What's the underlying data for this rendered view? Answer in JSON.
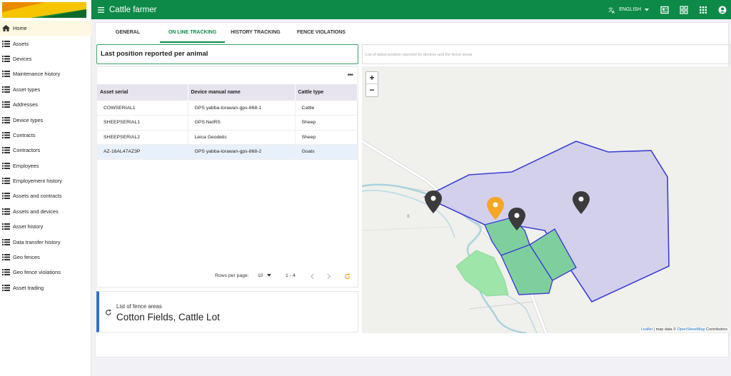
{
  "app": {
    "title": "Cattle farmer"
  },
  "topbar": {
    "language": "ENGLISH"
  },
  "sidebar": {
    "items": [
      {
        "label": "Home",
        "icon": "home-icon",
        "active": true
      },
      {
        "label": "Assets",
        "icon": "list-icon"
      },
      {
        "label": "Devices",
        "icon": "list-icon"
      },
      {
        "label": "Maintenance history",
        "icon": "list-icon"
      },
      {
        "label": "Asset types",
        "icon": "list-icon"
      },
      {
        "label": "Addresses",
        "icon": "list-icon"
      },
      {
        "label": "Device types",
        "icon": "list-icon"
      },
      {
        "label": "Contracts",
        "icon": "list-icon"
      },
      {
        "label": "Contractors",
        "icon": "list-icon"
      },
      {
        "label": "Employees",
        "icon": "list-icon"
      },
      {
        "label": "Employement history",
        "icon": "list-icon"
      },
      {
        "label": "Assets and contracts",
        "icon": "list-icon"
      },
      {
        "label": "Assets and devices",
        "icon": "list-icon"
      },
      {
        "label": "Asset history",
        "icon": "list-icon"
      },
      {
        "label": "Data transfer history",
        "icon": "list-icon"
      },
      {
        "label": "Geo fences",
        "icon": "list-icon"
      },
      {
        "label": "Geo fence violations",
        "icon": "list-icon"
      },
      {
        "label": "Asset trading",
        "icon": "list-icon"
      }
    ]
  },
  "tabs": [
    {
      "label": "GENERAL"
    },
    {
      "label": "ON LINE TRACKING",
      "active": true
    },
    {
      "label": "HISTORY TRACKING"
    },
    {
      "label": "FENCE VIOLATIONS"
    }
  ],
  "panel": {
    "title": "Last position reported per animal"
  },
  "map_header": {
    "text": "List of latest position reported by devices and the fence areas"
  },
  "table": {
    "columns": [
      "Asset serial",
      "Device manual name",
      "Cattle type"
    ],
    "rows": [
      [
        "COWSERIAL1",
        "GPS yabba-lorawan-gps-868-1",
        "Cattle"
      ],
      [
        "SHEEPSERIAL1",
        "GPS NetRS",
        "Sheep"
      ],
      [
        "SHEEPSERIAL2",
        "Leica Geodetic",
        "Sheep"
      ],
      [
        "AZ-16AL47AZ3P",
        "GPS yabba-lorawan-gps-868-2",
        "Goats"
      ]
    ],
    "selected_row": 3
  },
  "pager": {
    "rows_label": "Rows per page:",
    "rows_value": "10",
    "range": "1 - 4"
  },
  "fences": {
    "label": "List of fence areas",
    "names": "Cotton Fields, Cattle Lot"
  },
  "map": {
    "zoom_in": "+",
    "zoom_out": "−",
    "road_label": "8",
    "attribution": {
      "leaflet": "Leaflet",
      "mid": " | map data © ",
      "osm": "OpenStreetMap",
      "end": " Contributors"
    }
  },
  "colors": {
    "primary": "#0d8a47",
    "fence_fill": "#cfccec",
    "fence_stroke": "#3c3fd6",
    "marker_dark": "#3b3b3b",
    "marker_active": "#f5a623",
    "accent_blue": "#2f6fd1"
  }
}
